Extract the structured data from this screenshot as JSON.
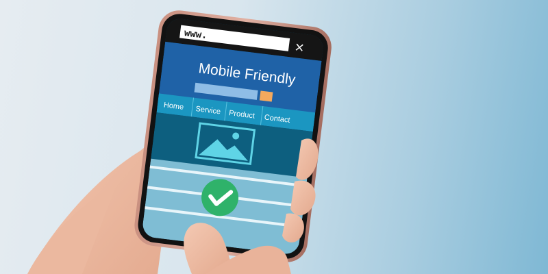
{
  "browser": {
    "url": "www.",
    "close_glyph": "×"
  },
  "site": {
    "title": "Mobile Friendly",
    "nav": [
      "Home",
      "Service",
      "Product",
      "Contact"
    ]
  },
  "icons": {
    "image_placeholder": "image-icon",
    "status": "checkmark-icon"
  },
  "colors": {
    "screen_dark": "#0a4b6b",
    "header_blue": "#1f62a7",
    "nav_cyan": "#1b96c1",
    "accent_orange": "#f5a95d",
    "check_green": "#2fb26a",
    "phone_frame": "#b98274"
  }
}
